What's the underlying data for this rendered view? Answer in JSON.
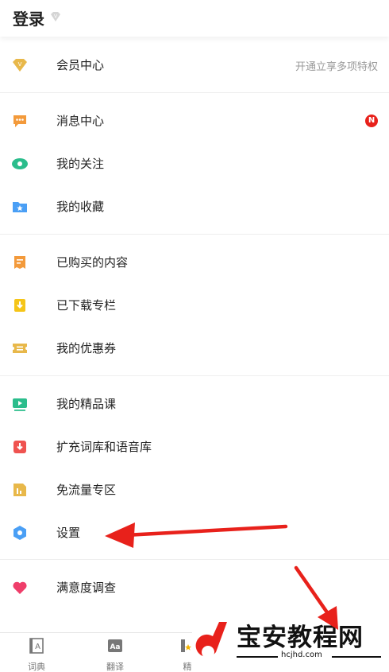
{
  "header": {
    "title": "登录"
  },
  "menu": {
    "vip": {
      "label": "会员中心",
      "promo": "开通立享多项特权"
    },
    "messages": {
      "label": "消息中心",
      "badge": "N"
    },
    "follows": {
      "label": "我的关注"
    },
    "favorites": {
      "label": "我的收藏"
    },
    "purchased": {
      "label": "已购买的内容"
    },
    "downloaded": {
      "label": "已下载专栏"
    },
    "coupons": {
      "label": "我的优惠券"
    },
    "courses": {
      "label": "我的精品课"
    },
    "expand": {
      "label": "扩充词库和语音库"
    },
    "free_data": {
      "label": "免流量专区"
    },
    "settings": {
      "label": "设置"
    },
    "survey": {
      "label": "满意度调查"
    }
  },
  "tabbar": {
    "tabs": [
      {
        "label": "词典",
        "icon": "dictionary-icon"
      },
      {
        "label": "翻译",
        "icon": "translate-icon"
      },
      {
        "label": "精",
        "icon": "premium-icon"
      }
    ]
  },
  "watermark": {
    "text": "宝安教程网",
    "url": "hcjhd.com"
  },
  "colors": {
    "vip_gold": "#e8b84a",
    "orange": "#f39a3b",
    "green": "#2bbd8c",
    "blue": "#4a9ff5",
    "yellow": "#f5c518",
    "red": "#ef5350",
    "badge_red": "#e8211b",
    "arrow_red": "#e8211b"
  }
}
